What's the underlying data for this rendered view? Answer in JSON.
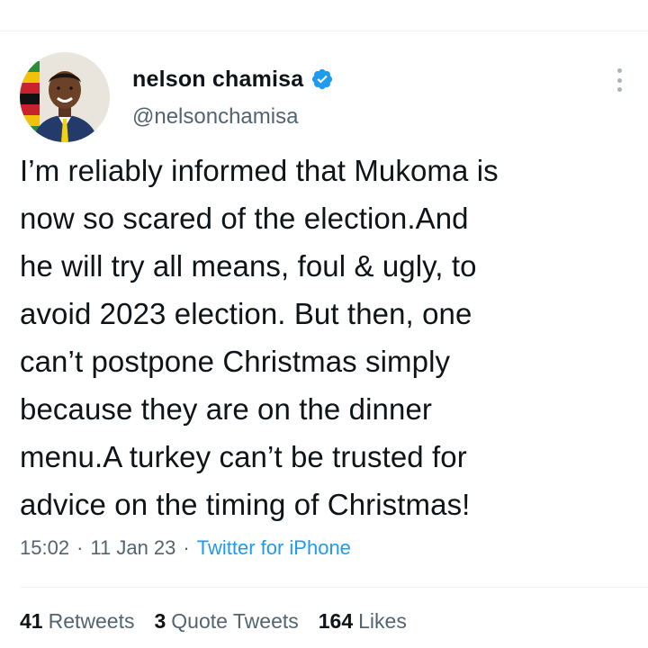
{
  "tweet": {
    "author": {
      "display_name": "nelson chamisa",
      "handle": "@nelsonchamisa",
      "verified": true,
      "avatar": "profile-photo"
    },
    "text": "I’m reliably informed that Mukoma is\nnow so scared of the election.And\nhe will try all means, foul & ugly, to\navoid 2023 election. But then, one\ncan’t postpone Christmas simply\nbecause they are on the dinner\nmenu.A turkey can’t be trusted for\nadvice on the timing of Christmas!",
    "time": "15:02",
    "date": "11 Jan 23",
    "separator": "·",
    "source": "Twitter for iPhone",
    "stats": {
      "retweets_count": "41",
      "retweets_label": "Retweets",
      "quotes_count": "3",
      "quotes_label": "Quote Tweets",
      "likes_count": "164",
      "likes_label": "Likes"
    }
  },
  "icons": {
    "verified": "verified-badge-icon",
    "more": "more-options-icon"
  },
  "colors": {
    "accent": "#1d9bf0",
    "text": "#0f1419",
    "secondary": "#536471",
    "divider": "#eff3f4"
  }
}
